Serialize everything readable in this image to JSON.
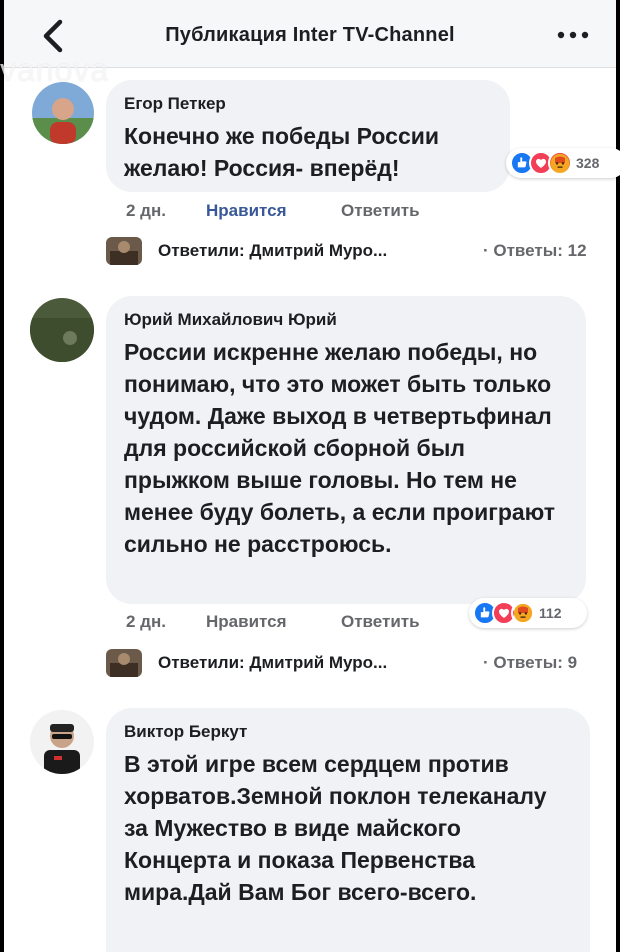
{
  "header": {
    "title": "Публикация Inter TV-Channel",
    "watermark": "vanova"
  },
  "comments": [
    {
      "author": "Егор Петкер",
      "text": "Конечно же победы России желаю! Россия- вперёд!",
      "time": "2 дн.",
      "like_label": "Нравится",
      "reply_label": "Ответить",
      "reaction_count": "328",
      "replies_label": "Ответили: Дмитрий Муро...",
      "replies_count": "· Ответы: 12"
    },
    {
      "author": "Юрий Михайлович Юрий",
      "text": "России искренне желаю победы, но понимаю, что это может быть только чудом. Даже выход в четвертьфинал для российской сборной был прыжком выше головы. Но тем не менее буду болеть, а если проиграют сильно не расстроюсь.",
      "time": "2 дн.",
      "like_label": "Нравится",
      "reply_label": "Ответить",
      "reaction_count": "112",
      "replies_label": "Ответили: Дмитрий Муро...",
      "replies_count": "· Ответы: 9"
    },
    {
      "author": "Виктор Беркут",
      "text": "В этой игре всем сердцем против хорватов.Земной поклон телеканалу за Мужество в виде майского Концерта и показа Первенства мира.Дай Вам Бог всего-всего."
    }
  ],
  "colors": {
    "like_blue": "#1877f2",
    "love_red": "#f33e58",
    "angry_orange": "#e9710f",
    "active_like_text": "#385898",
    "bubble_bg": "#f0f2f5"
  },
  "icons": [
    "back-chevron-icon",
    "more-dots-icon",
    "like-reaction-icon",
    "love-reaction-icon",
    "angry-reaction-icon"
  ]
}
